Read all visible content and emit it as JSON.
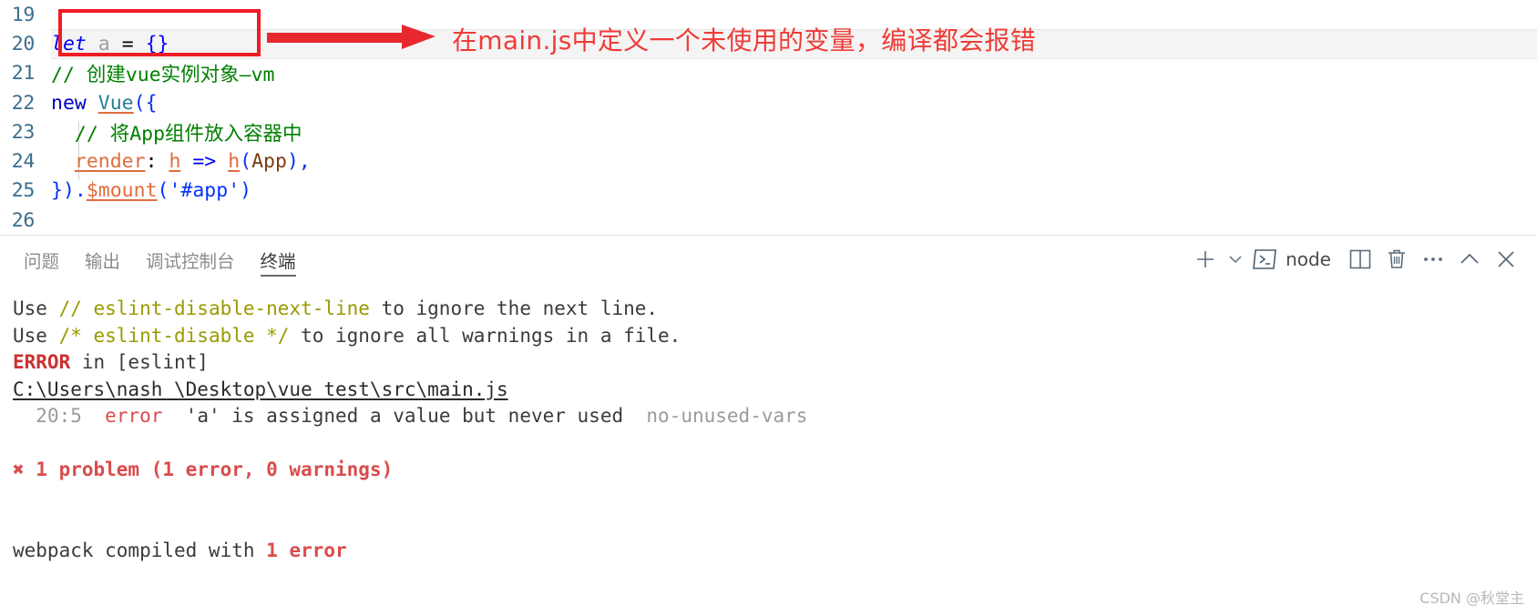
{
  "editor": {
    "lines": [
      {
        "num": "19",
        "tokens": []
      },
      {
        "num": "20",
        "tokens": [
          {
            "text": "let",
            "cls": "t-kw"
          },
          {
            "text": " ",
            "cls": "t-punct"
          },
          {
            "text": "a",
            "cls": "t-var"
          },
          {
            "text": " = ",
            "cls": "t-punct"
          },
          {
            "text": "{}",
            "cls": "t-brace"
          }
        ]
      },
      {
        "num": "21",
        "tokens": [
          {
            "text": "// 创建vue实例对象—vm",
            "cls": "t-comment"
          }
        ]
      },
      {
        "num": "22",
        "tokens": [
          {
            "text": "new ",
            "cls": "t-ctrl"
          },
          {
            "text": "Vue",
            "cls": "t-cls-u"
          },
          {
            "text": "({",
            "cls": "t-paren"
          }
        ]
      },
      {
        "num": "23",
        "tokens": [
          {
            "text": "  // 将App组件放入容器中",
            "cls": "t-comment"
          }
        ]
      },
      {
        "num": "24",
        "tokens": [
          {
            "text": "  ",
            "cls": "t-punct"
          },
          {
            "text": "render",
            "cls": "t-prop-u"
          },
          {
            "text": ": ",
            "cls": "t-punct"
          },
          {
            "text": "h",
            "cls": "t-prop-u"
          },
          {
            "text": " ",
            "cls": "t-punct"
          },
          {
            "text": "=>",
            "cls": "t-arrow"
          },
          {
            "text": " ",
            "cls": "t-punct"
          },
          {
            "text": "h",
            "cls": "t-prop-u"
          },
          {
            "text": "(",
            "cls": "t-paren"
          },
          {
            "text": "App",
            "cls": "t-ident"
          },
          {
            "text": "),",
            "cls": "t-paren"
          }
        ]
      },
      {
        "num": "25",
        "tokens": [
          {
            "text": "}).",
            "cls": "t-paren"
          },
          {
            "text": "$mount",
            "cls": "t-prop-u"
          },
          {
            "text": "(",
            "cls": "t-paren"
          },
          {
            "text": "'#app'",
            "cls": "t-str2"
          },
          {
            "text": ")",
            "cls": "t-paren"
          }
        ]
      },
      {
        "num": "26",
        "tokens": []
      }
    ]
  },
  "annotation": {
    "text": "在main.js中定义一个未使用的变量，编译都会报错",
    "box_color": "#ee1c25",
    "arrow_color": "#e8282f",
    "text_color": "#ef3b37"
  },
  "panel": {
    "tabs": [
      {
        "label": "问题",
        "active": false
      },
      {
        "label": "输出",
        "active": false
      },
      {
        "label": "调试控制台",
        "active": false
      },
      {
        "label": "终端",
        "active": true
      }
    ],
    "actions": {
      "new_terminal": "new-terminal-icon",
      "new_terminal_dropdown": "chevron-down-icon",
      "terminal_icon": "terminal-prompt-icon",
      "terminal_name": "node",
      "split": "split-terminal-icon",
      "kill": "trash-icon",
      "more": "ellipsis-icon",
      "collapse": "chevron-up-icon",
      "close": "close-icon"
    }
  },
  "terminal": {
    "lines": [
      {
        "segments": [
          {
            "text": "Use ",
            "cls": ""
          },
          {
            "text": "// eslint-disable-next-line",
            "cls": "c-yellow"
          },
          {
            "text": " to ignore the next line.",
            "cls": ""
          }
        ]
      },
      {
        "segments": [
          {
            "text": "Use ",
            "cls": ""
          },
          {
            "text": "/* eslint-disable */",
            "cls": "c-yellow"
          },
          {
            "text": " to ignore all warnings in a file.",
            "cls": ""
          }
        ]
      },
      {
        "segments": [
          {
            "text": "ERROR",
            "cls": "c-red"
          },
          {
            "text": " in [eslint]",
            "cls": ""
          }
        ]
      },
      {
        "segments": [
          {
            "text": "C:\\Users\\nash_\\Desktop\\vue_test\\src\\main.js",
            "cls": "c-link"
          }
        ]
      },
      {
        "segments": [
          {
            "text": "  ",
            "cls": ""
          },
          {
            "text": "20:5",
            "cls": "c-dim"
          },
          {
            "text": "  ",
            "cls": ""
          },
          {
            "text": "error",
            "cls": "c-redn"
          },
          {
            "text": "  'a' is assigned a value but never used  ",
            "cls": ""
          },
          {
            "text": "no-unused-vars",
            "cls": "c-dim"
          }
        ]
      },
      {
        "segments": []
      },
      {
        "segments": [
          {
            "text": "✖ 1 problem (1 error, 0 warnings)",
            "cls": "c-redn c-bold"
          }
        ]
      },
      {
        "segments": []
      },
      {
        "segments": []
      },
      {
        "segments": [
          {
            "text": "webpack compiled with ",
            "cls": ""
          },
          {
            "text": "1 error",
            "cls": "c-redn c-bold"
          }
        ]
      }
    ]
  },
  "watermark": {
    "text": "CSDN @秋堂主"
  }
}
